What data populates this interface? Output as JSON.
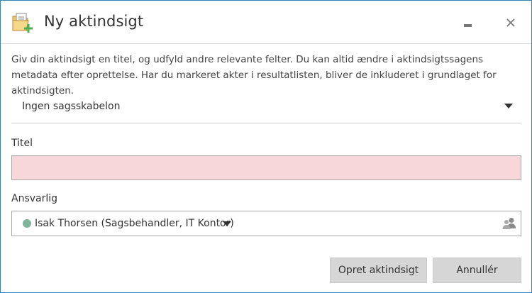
{
  "window": {
    "title": "Ny aktindsigt",
    "minimize_icon": "minimize-icon",
    "close_icon": "close-icon",
    "close_glyph": "✕"
  },
  "description": "Giv din aktindsigt en titel, og udfyld andre relevante felter. Du kan altid ændre i aktindsigtssagens metadata efter oprettelse. Har du markeret akter i resultatlisten, bliver de inkluderet i grundlaget for aktindsigten.",
  "template": {
    "selected": "Ingen sagsskabelon"
  },
  "title_field": {
    "label": "Titel",
    "value": "",
    "placeholder": ""
  },
  "responsible_field": {
    "label": "Ansvarlig",
    "selected": "Isak Thorsen (Sagsbehandler, IT Kontor)",
    "status_color": "#7fb59b"
  },
  "buttons": {
    "create": "Opret aktindsigt",
    "cancel": "Annullér"
  },
  "colors": {
    "window_border": "#3c7fb1",
    "required_field_bg": "#f8d7db",
    "button_bg": "#d6d6d6",
    "icon_green": "#4caf50",
    "icon_folder": "#f3c971"
  }
}
